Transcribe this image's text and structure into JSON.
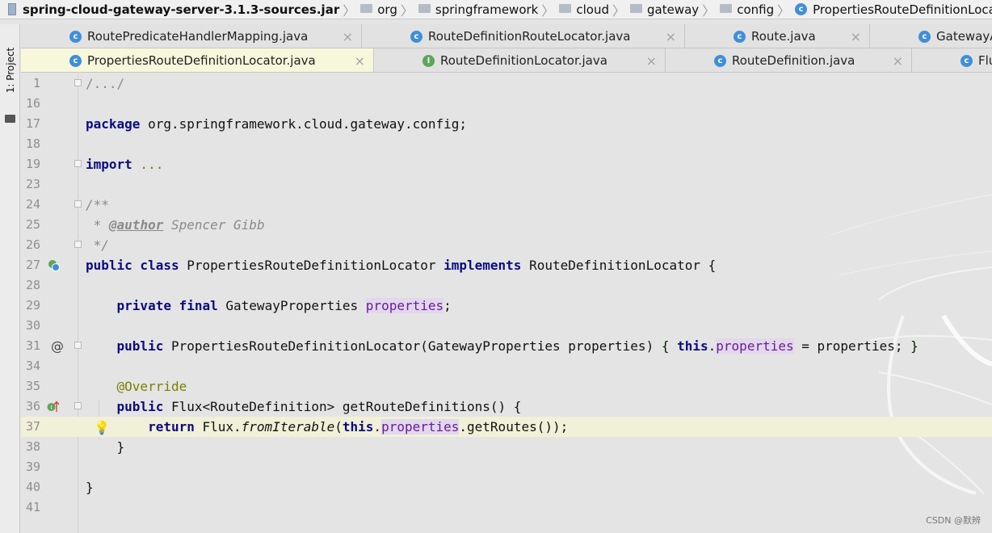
{
  "breadcrumb": [
    {
      "label": "spring-cloud-gateway-server-3.1.3-sources.jar",
      "icon": "jar-icon"
    },
    {
      "label": "org",
      "icon": "folder-icon"
    },
    {
      "label": "springframework",
      "icon": "folder-icon"
    },
    {
      "label": "cloud",
      "icon": "folder-icon"
    },
    {
      "label": "gateway",
      "icon": "folder-icon"
    },
    {
      "label": "config",
      "icon": "folder-icon"
    },
    {
      "label": "PropertiesRouteDefinitionLocator",
      "icon": "class-icon"
    }
  ],
  "side_panel": {
    "project_label": "1: Project"
  },
  "tabs_row1": [
    {
      "label": "RoutePredicateHandlerMapping.java",
      "icon": "class-icon",
      "close": "×"
    },
    {
      "label": "RouteDefinitionRouteLocator.java",
      "icon": "class-icon",
      "close": "×"
    },
    {
      "label": "Route.java",
      "icon": "class-icon",
      "close": "×"
    },
    {
      "label": "GatewayA",
      "icon": "class-icon",
      "close": ""
    }
  ],
  "tabs_row2": [
    {
      "label": "PropertiesRouteDefinitionLocator.java",
      "icon": "class-icon",
      "close": "×",
      "active": true
    },
    {
      "label": "RouteDefinitionLocator.java",
      "icon": "interface-icon",
      "close": "×"
    },
    {
      "label": "RouteDefinition.java",
      "icon": "class-icon",
      "close": "×"
    },
    {
      "label": "Flu",
      "icon": "class-icon",
      "close": ""
    }
  ],
  "editor": {
    "line_numbers": [
      "1",
      "16",
      "17",
      "18",
      "19",
      "23",
      "24",
      "25",
      "26",
      "27",
      "28",
      "29",
      "30",
      "31",
      "34",
      "35",
      "36",
      "37",
      "38",
      "39",
      "40",
      "41"
    ],
    "code": {
      "l1": "/.../",
      "l17_kw": "package",
      "l17_rest": " org.springframework.cloud.gateway.config;",
      "l19_kw": "import",
      "l19_rest": " ...",
      "l24": "/**",
      "l25_star": " * ",
      "l25_tag": "@author",
      "l25_rest": " Spencer Gibb",
      "l26": " */",
      "l27_kw1": "public class",
      "l27_name": " PropertiesRouteDefinitionLocator ",
      "l27_kw2": "implements",
      "l27_rest": " RouteDefinitionLocator {",
      "l29_indent": "    ",
      "l29_kw": "private final",
      "l29_type": " GatewayProperties ",
      "l29_field": "properties",
      "l29_end": ";",
      "l31_indent": "    ",
      "l31_kw": "public",
      "l31_mid": " PropertiesRouteDefinitionLocator(GatewayProperties properties) ",
      "l31_open": "{",
      "l31_sp": " ",
      "l31_this": "this",
      "l31_dot": ".",
      "l31_field": "properties",
      "l31_rest": " = properties; ",
      "l31_close": "}",
      "l35_indent": "    ",
      "l35_an": "@Override",
      "l36_indent": "    ",
      "l36_kw": "public",
      "l36_rest": " Flux<RouteDefinition> getRouteDefinitions() {",
      "l37_indent": "        ",
      "l37_kw": "return",
      "l37_a": " Flux.",
      "l37_method": "fromIterable",
      "l37_b": "(",
      "l37_this": "this",
      "l37_dot": ".",
      "l37_field": "properties",
      "l37_rest": ".getRoutes());",
      "l38": "    }",
      "l40": "}"
    }
  },
  "gutter_icons": {
    "implements": "implements-class-icon",
    "at": "@",
    "override": "override-up-arrow-icon",
    "bulb": "💡"
  },
  "watermark": "CSDN @默辨",
  "colors": {
    "keyword": "#0b0b80",
    "field": "#6b1a9a",
    "annotation": "#7e7e00",
    "comment": "#8a8a8a",
    "current_line": "#f1f0d8",
    "active_tab": "#f7f7dc"
  }
}
